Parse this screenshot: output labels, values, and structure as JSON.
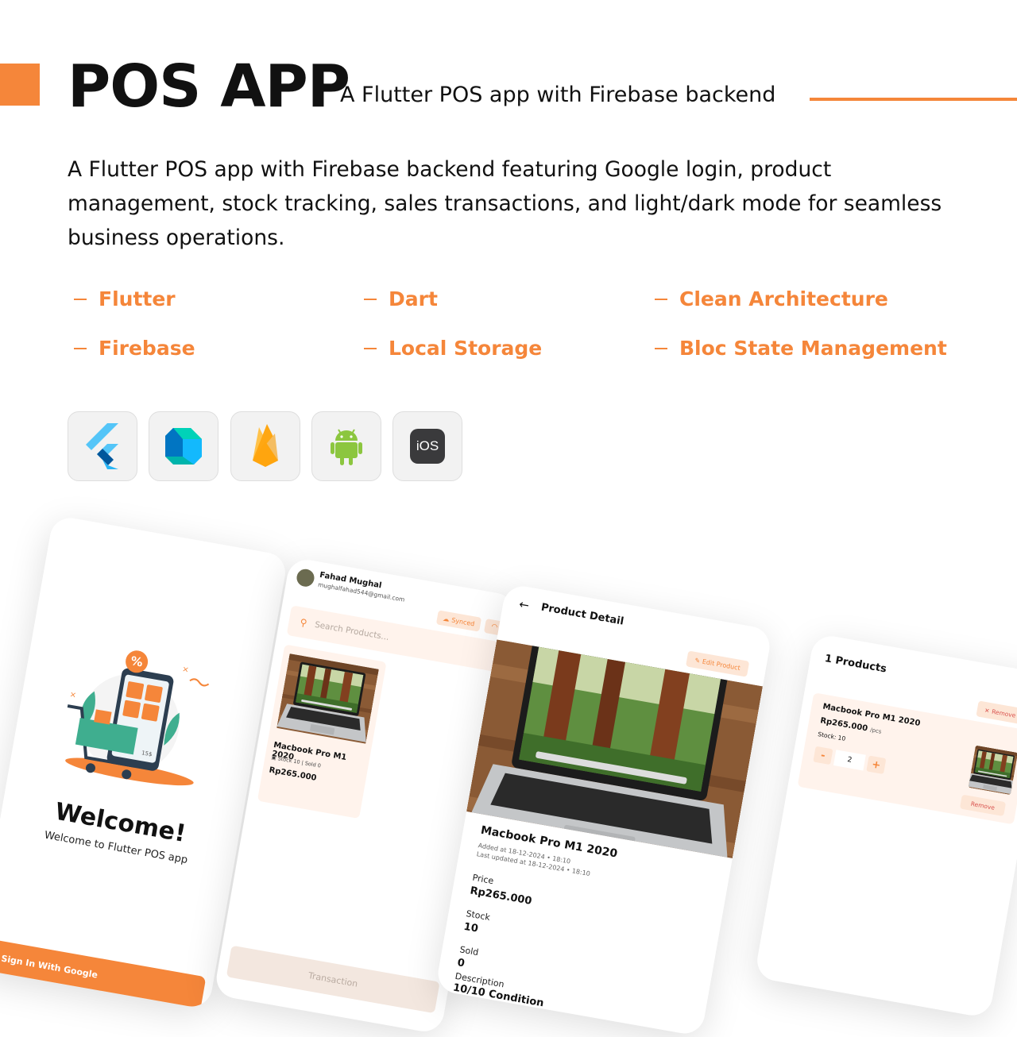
{
  "header": {
    "title": "POS APP",
    "subtitle": "A Flutter POS app with Firebase backend",
    "description": "A Flutter POS app with Firebase backend featuring Google login, product management, stock tracking, sales transactions, and light/dark mode for seamless business operations."
  },
  "tags": [
    "Flutter",
    "Dart",
    "Clean Architecture",
    "Firebase",
    "Local Storage",
    "Bloc State Management"
  ],
  "tech_icons": [
    "flutter-icon",
    "dart-icon",
    "firebase-icon",
    "android-icon",
    "ios-icon"
  ],
  "ios_label": "iOS",
  "colors": {
    "accent": "#F5863A",
    "tint": "#fff3ec",
    "danger": "#d9534f"
  },
  "welcome_screen": {
    "title": "Welcome!",
    "subtitle": "Welcome to Flutter POS app",
    "signin_label": "Sign In With Google",
    "illustration_badge": "%",
    "illustration_price": "15$"
  },
  "home_screen": {
    "user_name": "Fahad Mughal",
    "user_email": "mughalfahad544@gmail.com",
    "synced_label": "Synced",
    "search_placeholder": "Search Products...",
    "product": {
      "name": "Macbook Pro M1 2020",
      "meta": "Stock 10 | Sold 0",
      "price": "Rp265.000"
    },
    "transaction_label": "Transaction"
  },
  "detail_screen": {
    "title": "Product Detail",
    "edit_label": "Edit Product",
    "product_name": "Macbook Pro M1 2020",
    "added_at": "Added at 18-12-2024 • 18:10",
    "updated_at": "Last updated at 18-12-2024 • 18:10",
    "fields": [
      {
        "label": "Price",
        "value": "Rp265.000"
      },
      {
        "label": "Stock",
        "value": "10"
      },
      {
        "label": "Sold",
        "value": "0"
      },
      {
        "label": "Description",
        "value": "10/10 Condition"
      }
    ]
  },
  "cart_screen": {
    "title": "1 Products",
    "remove_all_label": "Remove All",
    "item": {
      "name": "Macbook Pro M1 2020",
      "price": "Rp265.000",
      "unit": "/pcs",
      "stock": "Stock: 10",
      "quantity": "2",
      "remove_label": "Remove"
    }
  }
}
